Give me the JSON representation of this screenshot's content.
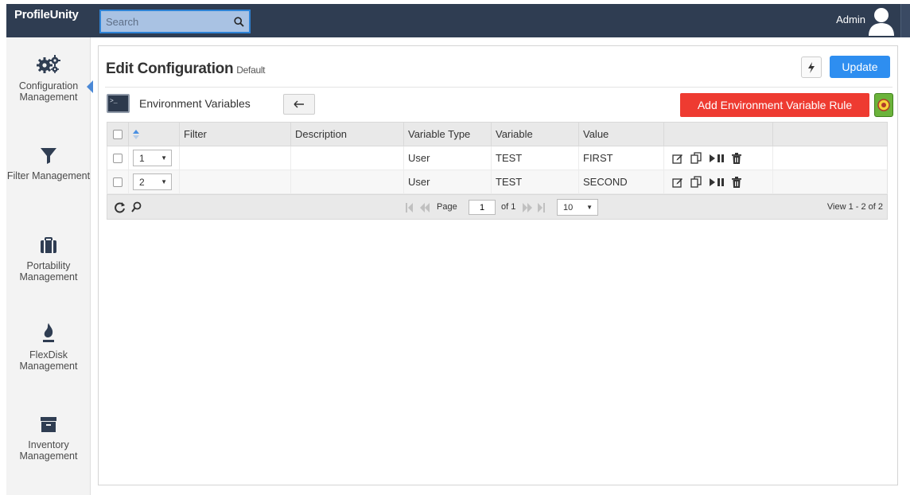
{
  "app": {
    "brand": "ProfileUnity"
  },
  "search": {
    "placeholder": "Search",
    "value": ""
  },
  "user": {
    "name": "Admin"
  },
  "sidebar": {
    "items": [
      {
        "label": "Configuration Management",
        "icon": "gears-icon",
        "active": true
      },
      {
        "label": "Filter Management",
        "icon": "filter-icon"
      },
      {
        "label": "Portability Management",
        "icon": "briefcase-icon"
      },
      {
        "label": "FlexDisk Management",
        "icon": "flame-icon"
      },
      {
        "label": "Inventory Management",
        "icon": "archive-box-icon"
      }
    ]
  },
  "page": {
    "title": "Edit Configuration",
    "subtitle": "Default",
    "update_label": "Update"
  },
  "section": {
    "title": "Environment Variables",
    "add_rule_label": "Add Environment Variable Rule"
  },
  "grid": {
    "columns": [
      "Filter",
      "Description",
      "Variable Type",
      "Variable",
      "Value"
    ],
    "rows": [
      {
        "order": "1",
        "filter": "",
        "description": "",
        "variable_type": "User",
        "variable": "TEST",
        "value": "FIRST"
      },
      {
        "order": "2",
        "filter": "",
        "description": "",
        "variable_type": "User",
        "variable": "TEST",
        "value": "SECOND"
      }
    ],
    "pager": {
      "page_label": "Page",
      "page_value": "1",
      "of_label": "of 1",
      "rows_per_page": "10",
      "summary": "View 1 - 2 of 2"
    }
  },
  "colors": {
    "topbar": "#2f3d52",
    "accent_blue": "#2e8ef0",
    "add_rule_red": "#ee3b31",
    "sidebar_bg": "#f3f3f3"
  }
}
